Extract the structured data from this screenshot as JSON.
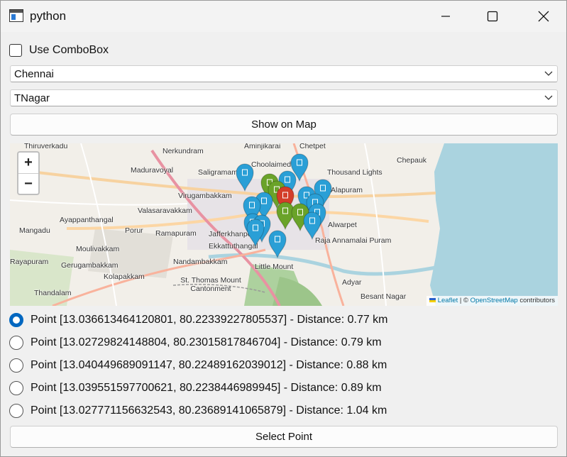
{
  "window": {
    "title": "python",
    "icon": "python-app-icon"
  },
  "controls": {
    "use_combobox_label": "Use ComboBox",
    "use_combobox_checked": false,
    "city_value": "Chennai",
    "area_value": "TNagar",
    "show_map_label": "Show on Map",
    "select_point_label": "Select Point"
  },
  "map": {
    "zoom_in": "+",
    "zoom_out": "−",
    "places": [
      "Thiruverkadu",
      "Nerkundram",
      "Aminjikarai",
      "Chetpet",
      "Choolaimedu",
      "Thousand Lights",
      "Chepauk",
      "Maduravoyal",
      "Saligramam",
      "Virugambakkam",
      "Alapuram",
      "Valasaravakkam",
      "Ayappanthangal",
      "Mangadu",
      "Porur",
      "Ramapuram",
      "Alwarpet",
      "Raja Annamalai Puram",
      "Moulivakkam",
      "Jafferkhanpet",
      "Ekkattuthangal",
      "Rayapuram",
      "Gerugambakkam",
      "Nandambakkam",
      "Little Mount",
      "Kolapakkam",
      "St. Thomas Mount Cantonment",
      "Adyar",
      "Besant Nagar",
      "Thandalam"
    ],
    "attribution": {
      "leaflet": "Leaflet",
      "separator": " | © ",
      "osm": "OpenStreetMap",
      "suffix": " contributors"
    },
    "marker_colors": {
      "blue": "#2a9fd6",
      "green": "#6aa329",
      "red": "#d33d29"
    }
  },
  "points": [
    {
      "label": "Point [13.036613464120801, 80.22339227805537] - Distance: 0.77 km",
      "selected": true
    },
    {
      "label": "Point [13.02729824148804, 80.23015817846704] - Distance: 0.79 km",
      "selected": false
    },
    {
      "label": "Point [13.040449689091147, 80.22489162039012] - Distance: 0.88 km",
      "selected": false
    },
    {
      "label": "Point [13.039551597700621, 80.2238446989945] - Distance: 0.89 km",
      "selected": false
    },
    {
      "label": "Point [13.027771156632543, 80.23689141065879] - Distance: 1.04 km",
      "selected": false
    }
  ]
}
